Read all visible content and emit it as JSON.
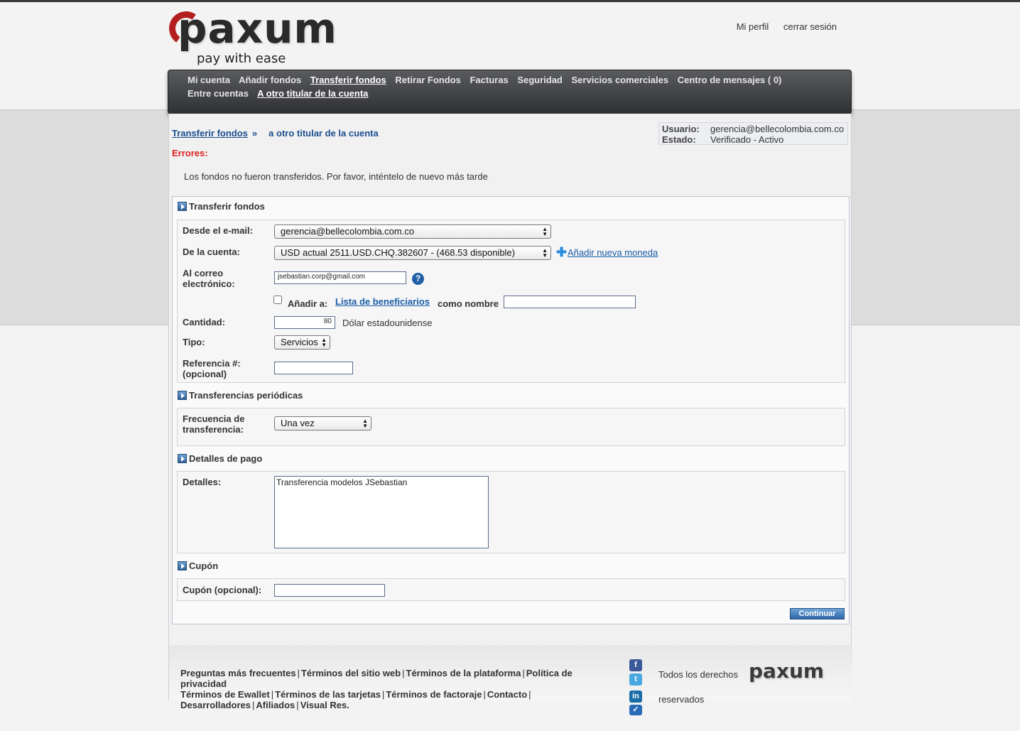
{
  "brand": {
    "name": "paxum",
    "tagline": "pay with ease"
  },
  "top_links": {
    "profile": "Mi perfil",
    "logout": "cerrar sesión"
  },
  "nav": {
    "row1": [
      "Mi cuenta",
      "Añadir fondos",
      "Transferir fondos",
      "Retirar Fondos",
      "Facturas",
      "Seguridad",
      "Servicios comerciales",
      "Centro de mensajes ( 0)"
    ],
    "row2": [
      "Entre cuentas",
      "A otro titular de la cuenta"
    ]
  },
  "breadcrumb": {
    "parent": "Transferir fondos",
    "separator": "»",
    "current": "a otro titular de la cuenta"
  },
  "user_info": {
    "user_label": "Usuario:",
    "user_value": "gerencia@bellecolombia.com.co",
    "status_label": "Estado:",
    "status_value": "Verificado - Activo"
  },
  "errors": {
    "label": "Errores:",
    "message": "Los fondos no fueron transferidos. Por favor, inténtelo de nuevo más tarde"
  },
  "transfer": {
    "title": "Transferir fondos",
    "from_email_label": "Desde el e-mail:",
    "from_email_value": "gerencia@bellecolombia.com.co",
    "account_label": "De la cuenta:",
    "account_value": "USD actual 2511.USD.CHQ.382607 - (468.53 disponible)",
    "add_currency": "Añadir nueva moneda",
    "to_email_label_1": "Al correo",
    "to_email_label_2": "electrónico:",
    "to_email_value": "jsebastian.corp@gmail.com",
    "help": "?",
    "add_to_label": "Añadir a:",
    "beneficiaries_link": "Lista de beneficiarios",
    "as_name_label": "como nombre",
    "amount_label": "Cantidad:",
    "amount_value": "80",
    "currency_name": "Dólar estadounidense",
    "type_label": "Tipo:",
    "type_value": "Servicios",
    "reference_label_1": "Referencia #:",
    "reference_label_2": "(opcional)"
  },
  "periodic": {
    "title": "Transferencias periódicas",
    "freq_label_1": "Frecuencia de",
    "freq_label_2": "transferencia:",
    "freq_value": "Una vez"
  },
  "payment": {
    "title": "Detalles de pago",
    "details_label": "Detalles:",
    "details_value": "Transferencia modelos JSebastian"
  },
  "coupon": {
    "title": "Cupón",
    "coupon_label": "Cupón (opcional):"
  },
  "continue_button": "Continuar",
  "footer": {
    "links": [
      "Preguntas más frecuentes",
      "Términos del sitio web",
      "Términos de la plataforma",
      "Política de privacidad",
      "Términos de Ewallet",
      "Términos de las tarjetas",
      "Términos de factoraje",
      "Contacto",
      "Desarrolladores",
      "Afiliados",
      "Visual Res."
    ],
    "rights_1": "Todos los derechos",
    "rights_2": "reservados",
    "logo": "paxum",
    "social": [
      {
        "name": "facebook-icon",
        "glyph": "f",
        "color": "#3b5998"
      },
      {
        "name": "twitter-icon",
        "glyph": "t",
        "color": "#4aa8e0"
      },
      {
        "name": "linkedin-icon",
        "glyph": "in",
        "color": "#1a6ea8"
      },
      {
        "name": "delicious-icon",
        "glyph": "✓",
        "color": "#2a6bb8"
      }
    ]
  }
}
